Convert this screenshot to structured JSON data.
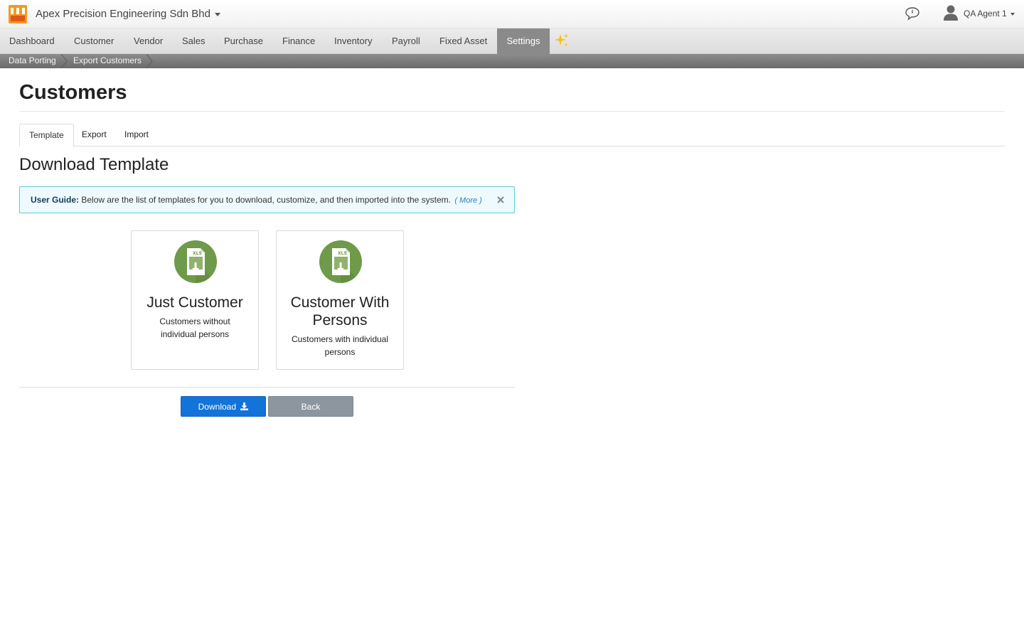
{
  "header": {
    "company_name": "Apex Precision Engineering Sdn Bhd",
    "user_name": "QA Agent 1",
    "logo_icon": "store-icon",
    "chat_icon": "chat-bubble-icon",
    "user_icon": "user-icon"
  },
  "nav": {
    "items": [
      {
        "label": "Dashboard"
      },
      {
        "label": "Customer"
      },
      {
        "label": "Vendor"
      },
      {
        "label": "Sales"
      },
      {
        "label": "Purchase"
      },
      {
        "label": "Finance"
      },
      {
        "label": "Inventory"
      },
      {
        "label": "Payroll"
      },
      {
        "label": "Fixed Asset"
      },
      {
        "label": "Settings"
      }
    ],
    "active": "Settings",
    "extra_icon": "sparkles-icon"
  },
  "breadcrumb": {
    "items": [
      "Data Porting",
      "Export Customers"
    ]
  },
  "page": {
    "title": "Customers",
    "tabs": [
      {
        "label": "Template"
      },
      {
        "label": "Export"
      },
      {
        "label": "Import"
      }
    ],
    "active_tab": "Template",
    "section_title": "Download Template",
    "guide": {
      "label": "User Guide:",
      "text": "Below are the list of templates for you to download, customize, and then imported into the system.",
      "more": "( More )"
    },
    "cards": [
      {
        "title": "Just Customer",
        "desc": "Customers without individual persons",
        "icon": "xls-download-icon"
      },
      {
        "title": "Customer With Persons",
        "desc": "Customers with individual persons",
        "icon": "xls-download-icon"
      }
    ],
    "buttons": {
      "download": "Download",
      "back": "Back"
    }
  },
  "colors": {
    "primary": "#1473d8",
    "secondary": "#8d969e",
    "icon_green": "#6f9a4a",
    "nav_active": "#8a8a8a",
    "logo_orange": "#f29a1f"
  }
}
